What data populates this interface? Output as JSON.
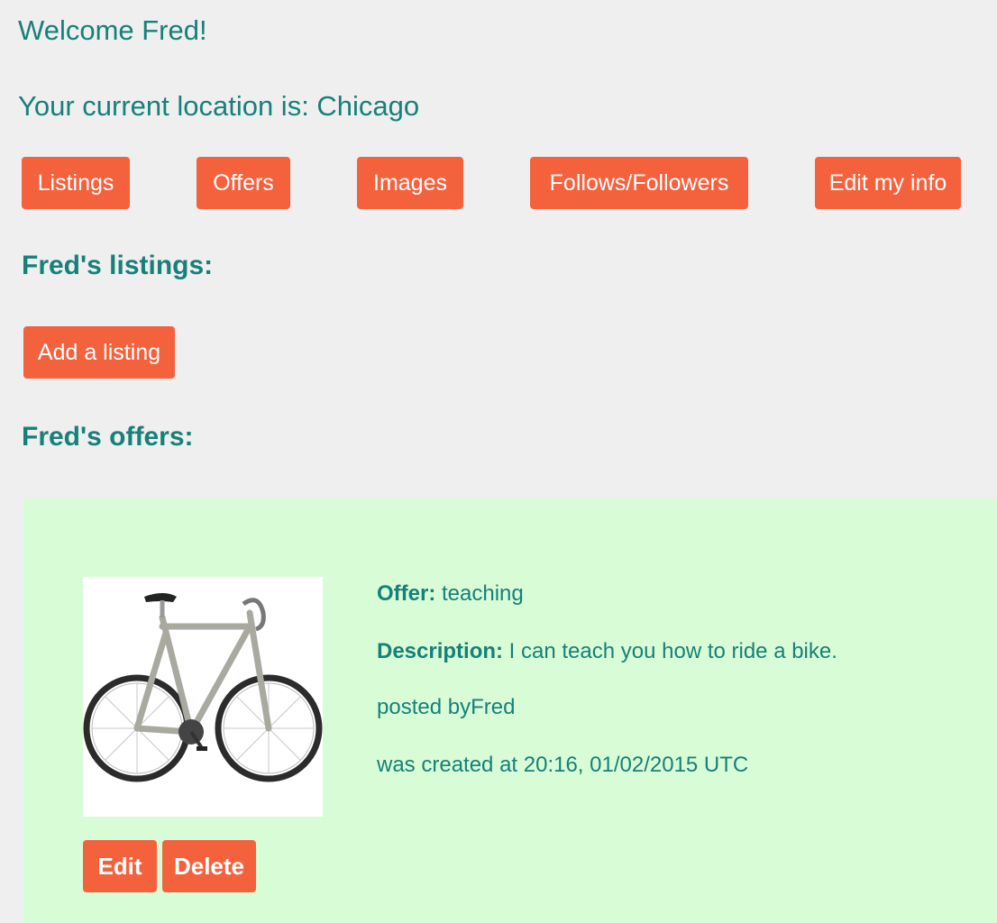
{
  "header": {
    "welcome": "Welcome Fred!",
    "location": "Your current location is: Chicago"
  },
  "nav": {
    "listings": "Listings",
    "offers": "Offers",
    "images": "Images",
    "follows": "Follows/Followers",
    "edit_info": "Edit my info"
  },
  "listings_section": {
    "heading": "Fred's listings:",
    "add_button": "Add a listing"
  },
  "offers_section": {
    "heading": "Fred's offers:",
    "offer": {
      "image_icon": "bicycle-image",
      "offer_label": "Offer:",
      "offer_value": " teaching",
      "description_label": "Description:",
      "description_value": " I can teach you how to ride a bike.",
      "posted_by": "posted byFred",
      "created_at": "was created at 20:16, 01/02/2015 UTC",
      "edit_button": "Edit",
      "delete_button": "Delete"
    }
  },
  "colors": {
    "accent": "#f4623d",
    "text": "#17807a",
    "background": "#efefef",
    "card_background": "#d8fdd6"
  }
}
